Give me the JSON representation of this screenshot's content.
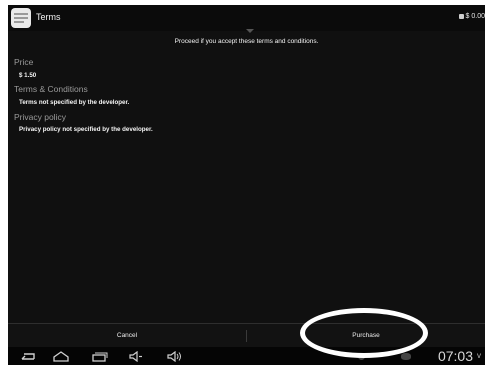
{
  "header": {
    "title": "Terms",
    "balance": "$ 0.00"
  },
  "notice": "Proceed if you accept these terms and conditions.",
  "sections": [
    {
      "label": "Price",
      "value": "$ 1.50"
    },
    {
      "label": "Terms & Conditions",
      "value": "Terms not specified by the developer."
    },
    {
      "label": "Privacy policy",
      "value": "Privacy policy not specified by the developer."
    }
  ],
  "footer": {
    "cancel": "Cancel",
    "purchase": "Purchase"
  },
  "status": {
    "time": "07:03",
    "indicator": "v"
  },
  "icons": [
    "app-icon",
    "wallet-icon",
    "back-icon",
    "home-icon",
    "recent-apps-icon",
    "volume-down-icon",
    "volume-up-icon"
  ],
  "colors": {
    "background": "#101010",
    "highlight": "#ffffff",
    "label": "#9a9a9a"
  }
}
